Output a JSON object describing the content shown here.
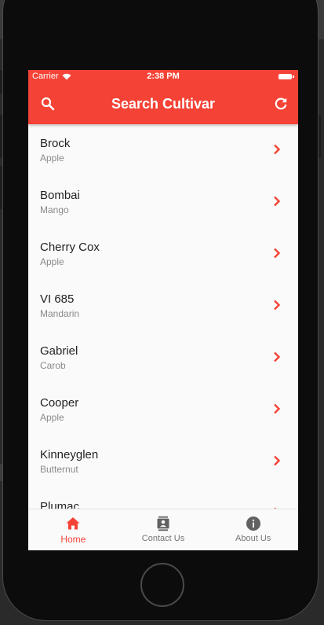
{
  "status_bar": {
    "carrier": "Carrier",
    "time": "2:38 PM"
  },
  "app_bar": {
    "title": "Search Cultivar",
    "left_icon": "search-icon",
    "right_icon": "refresh-icon"
  },
  "list": {
    "items": [
      {
        "title": "Brock",
        "subtitle": "Apple"
      },
      {
        "title": "Bombai",
        "subtitle": "Mango"
      },
      {
        "title": "Cherry Cox",
        "subtitle": "Apple"
      },
      {
        "title": "VI 685",
        "subtitle": "Mandarin"
      },
      {
        "title": "Gabriel",
        "subtitle": "Carob"
      },
      {
        "title": "Cooper",
        "subtitle": "Apple"
      },
      {
        "title": "Kinneyglen",
        "subtitle": "Butternut"
      },
      {
        "title": "Plumac",
        "subtitle": ""
      }
    ]
  },
  "bottom_nav": {
    "items": [
      {
        "label": "Home",
        "icon": "home-icon",
        "active": true
      },
      {
        "label": "Contact Us",
        "icon": "contact-card-icon",
        "active": false
      },
      {
        "label": "About Us",
        "icon": "info-icon",
        "active": false
      }
    ]
  },
  "colors": {
    "accent": "#f44336",
    "background": "#fafafa",
    "inactive": "#757575"
  }
}
